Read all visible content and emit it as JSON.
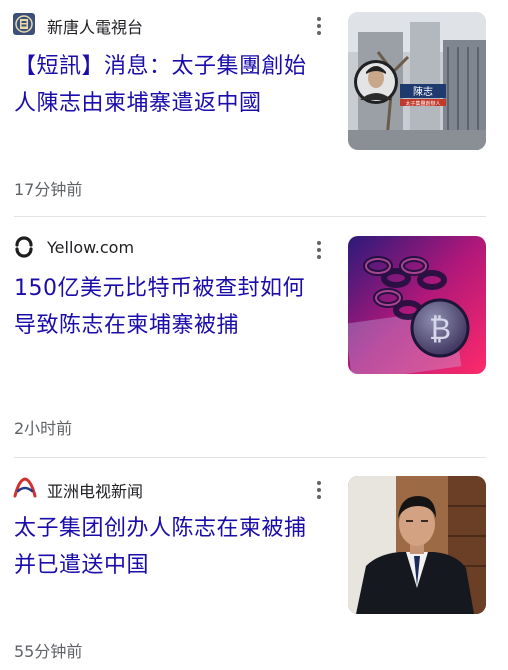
{
  "articles": [
    {
      "source": {
        "name": "新唐人電視台",
        "icon": "ntd-logo-icon",
        "brand_color": "#3b4f7a"
      },
      "headline_lines": [
        "【短訊】消息：太子集團創始",
        "人陳志由柬埔寨遣返中國"
      ],
      "time": "17分钟前",
      "thumbnail": {
        "icon": "news-photo-building-portrait",
        "caption_name": "陳志",
        "caption_sub": "太子集團創辦人"
      }
    },
    {
      "source": {
        "name": "Yellow.com",
        "icon": "yellow-logo-icon",
        "brand_color": "#1f1f1f"
      },
      "headline_lines": [
        "150亿美元比特币被查封如何",
        "导致陈志在柬埔寨被捕"
      ],
      "time": "2小时前",
      "thumbnail": {
        "icon": "bitcoin-chain-photo"
      }
    },
    {
      "source": {
        "name": "亚洲电视新闻",
        "icon": "ani-logo-icon",
        "brand_color": "#d32f2f"
      },
      "headline_lines": [
        "太子集团创办人陈志在柬被捕",
        "并已遣送中国"
      ],
      "time": "55分钟前",
      "thumbnail": {
        "icon": "man-in-suit-photo"
      }
    }
  ],
  "colors": {
    "headline": "#1a0dab",
    "meta": "#5f6368",
    "divider": "#e3e3e3"
  },
  "menu_icon": "more-vert-icon"
}
